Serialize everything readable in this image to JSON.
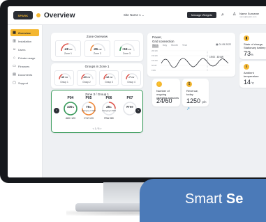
{
  "app": {
    "logo_text": "SPARK",
    "page_title": "Overview",
    "site_select": "Site Name 1",
    "manage_widgets": "Manage Widgets",
    "user_name": "Name Surname",
    "user_email": "name@spark.com"
  },
  "sidebar": {
    "items": [
      {
        "label": "Overview",
        "icon": "grid-icon",
        "active": true
      },
      {
        "label": "Installation",
        "icon": "building-icon"
      },
      {
        "label": "Users",
        "icon": "users-icon"
      },
      {
        "label": "Private usage",
        "icon": "home-icon"
      },
      {
        "label": "Finances",
        "icon": "wallet-icon"
      },
      {
        "label": "Documents",
        "icon": "document-icon"
      },
      {
        "label": "Support",
        "icon": "chat-icon"
      }
    ]
  },
  "zone_overview": {
    "title": "Zone Overview",
    "zones": [
      {
        "value": "-49",
        "unit": "kW",
        "label": "Zone 1",
        "level": 0.5,
        "color": "#e0534a"
      },
      {
        "value": "-26",
        "unit": "kW",
        "label": "Zone 2",
        "level": 0.3,
        "color": "#f08a3c"
      },
      {
        "value": "+15",
        "unit": "kW",
        "label": "Zone 3",
        "level": 0.2,
        "color": "#3a9b5c"
      }
    ]
  },
  "groups": {
    "title": "Groups in Zone 1",
    "items": [
      {
        "value": "-10",
        "unit": "kW",
        "label": "Group 1",
        "color": "#e0534a"
      },
      {
        "value": "-20",
        "unit": "kW",
        "label": "Group 2",
        "color": "#e0534a"
      },
      {
        "value": "-12",
        "unit": "kW",
        "label": "Group 3",
        "color": "#e0534a"
      },
      {
        "value": "-7",
        "unit": "kW",
        "label": "Group 4",
        "color": "#e0534a"
      }
    ]
  },
  "zone_group": {
    "title": "Zone 3 / Group 1",
    "chargers": [
      {
        "name": "P04",
        "value": "100",
        "unit": "%",
        "state": "",
        "plate": "ABC 123",
        "level": 1.0,
        "color": "#3a9b5c"
      },
      {
        "name": "P05",
        "value": "75",
        "unit": "%",
        "state": "Charging 1.5kW",
        "plate": "XYZ 123",
        "level": 0.75,
        "color": "#f08a3c"
      },
      {
        "name": "P06",
        "value": "25",
        "unit": "%",
        "state": "Charging 1.5kW",
        "plate": "FBA 969",
        "level": 0.25,
        "color": "#e0534a"
      },
      {
        "name": "P07",
        "value": "Free",
        "unit": "",
        "state": "",
        "plate": "",
        "level": 0,
        "color": "#d0d3d8"
      }
    ],
    "pager": "< 1 / 5 >"
  },
  "power": {
    "title_line1": "Power,",
    "title_line2": "Grid connection",
    "tabs": [
      "Week",
      "Day",
      "Month",
      "Year"
    ],
    "active_tab": "Week",
    "date": "01.05.2022",
    "legend": "19:00 - 60 kW",
    "y_ticks": [
      "200 kW",
      "150 kW",
      "100 kW",
      "50 kW",
      "0 kW"
    ]
  },
  "sessions": {
    "label_line1": "Number of ongoing",
    "label_line2": "charging sessions",
    "value": "24/60"
  },
  "revenue": {
    "label_line1": "Revenue,",
    "label_line2": "today",
    "value": "1250",
    "unit": "pln"
  },
  "battery": {
    "label_line1": "State of charge,",
    "label_line2": "Stationary battery",
    "value": "73",
    "unit": "%"
  },
  "temperature": {
    "label_line1": "Ambient",
    "label_line2": "temperature",
    "value": "14",
    "unit": "°C"
  },
  "banner": {
    "text_plain": "Smart ",
    "text_bold": "Se"
  }
}
